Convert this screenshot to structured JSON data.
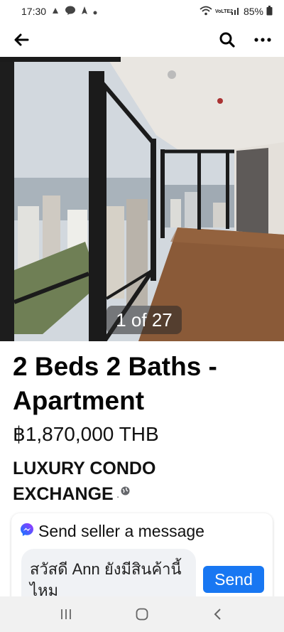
{
  "status_bar": {
    "time": "17:30",
    "battery": "85%",
    "network_label": "VoLTE2"
  },
  "nav": {
    "back_icon": "arrow-left-icon",
    "search_icon": "search-icon",
    "more_icon": "more-horizontal-icon"
  },
  "photo": {
    "counter": "1 of 27"
  },
  "listing": {
    "title": "2 Beds 2 Baths - Apartment",
    "price": "฿1,870,000 THB",
    "seller": "LUXURY CONDO EXCHANGE",
    "seller_separator": "·"
  },
  "message": {
    "heading": "Send seller a message",
    "input_value": "สวัสดี Ann ยังมีสินค้านี้ไหม",
    "send_label": "Send"
  },
  "colors": {
    "accent": "#1877f2",
    "messenger_gradient_start": "#0a7cff",
    "messenger_gradient_end": "#a033ff"
  }
}
